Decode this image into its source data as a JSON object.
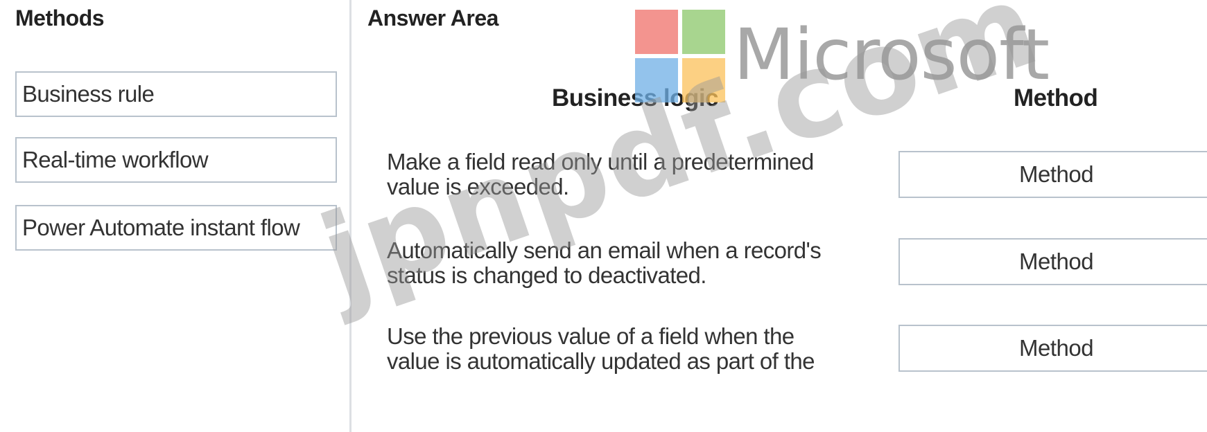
{
  "methods_panel": {
    "title": "Methods",
    "items": [
      {
        "label": "Business rule"
      },
      {
        "label": "Real-time workflow"
      },
      {
        "label": "Power Automate instant flow"
      }
    ]
  },
  "answer_area": {
    "title": "Answer Area",
    "column_headers": {
      "logic": "Business logic",
      "method": "Method"
    },
    "rows": [
      {
        "logic_line1": "Make a field read only until a predetermined",
        "logic_line2": "value is exceeded.",
        "target_label": "Method"
      },
      {
        "logic_line1": "Automatically send an email when a record's",
        "logic_line2": "status is changed to deactivated.",
        "target_label": "Method"
      },
      {
        "logic_line1": "Use the previous value of a field when the",
        "logic_line2": "value is automatically updated as part of the",
        "target_label": "Method"
      }
    ]
  },
  "overlay": {
    "logo_text": "Microsoft",
    "logo_colors": [
      "#f0716a",
      "#8cc76a",
      "#6fb0e6",
      "#fbc15a"
    ],
    "watermark_text": "jpnpdf.com"
  }
}
